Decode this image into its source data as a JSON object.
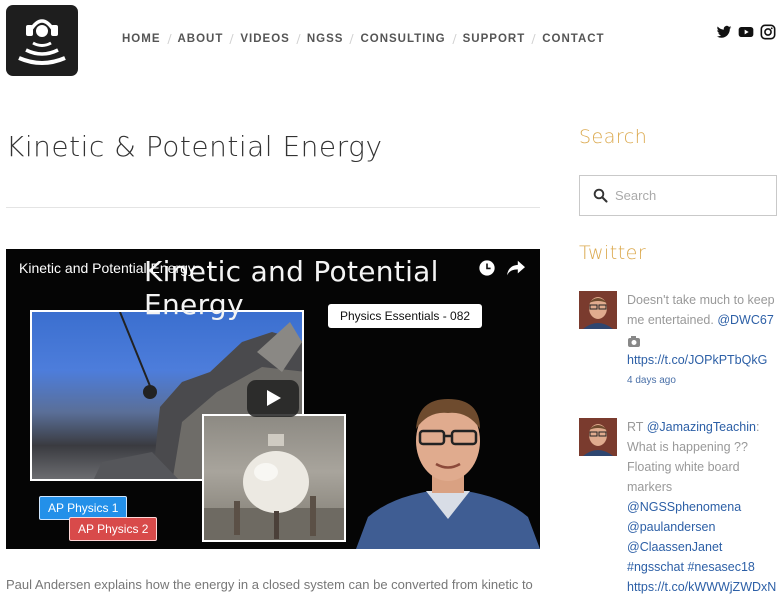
{
  "nav": {
    "items": [
      "HOME",
      "ABOUT",
      "VIDEOS",
      "NGSS",
      "CONSULTING",
      "SUPPORT",
      "CONTACT"
    ]
  },
  "social": [
    "twitter-icon",
    "youtube-icon",
    "instagram-icon"
  ],
  "page": {
    "title": "Kinetic & Potential Energy"
  },
  "video": {
    "top_title": "Kinetic and Potential Energy",
    "big_title": "Kinetic and Potential Energy",
    "label": "Physics Essentials - 082",
    "tag1": "AP Physics 1",
    "tag2": "AP Physics 2"
  },
  "description": "Paul Andersen explains how the energy in a closed system can be converted from kinetic to",
  "sidebar": {
    "search_heading": "Search",
    "search_placeholder": "Search",
    "twitter_heading": "Twitter"
  },
  "tweets": [
    {
      "text": "Doesn't take much to keep me entertained.",
      "mention": "@DWC67",
      "link": "https://t.co/JOPkPTbQkG",
      "time": "4 days ago"
    },
    {
      "prefix": "RT ",
      "mention1": "@JamazingTeachin",
      "text": ": What is happening ?? Floating white board markers",
      "mention2": "@NGSSphenomena",
      "mention3": "@paulandersen",
      "mention4": "@ClaassenJanet",
      "hashtag1": "#ngsschat",
      "hashtag2": "#nesasec18",
      "link": "https://t.co/kWWWjZWDxN"
    }
  ],
  "colors": {
    "accent": "#dba94e",
    "link": "#2c5fa6",
    "tag1": "#2390e9",
    "tag2": "#d84a4a"
  }
}
